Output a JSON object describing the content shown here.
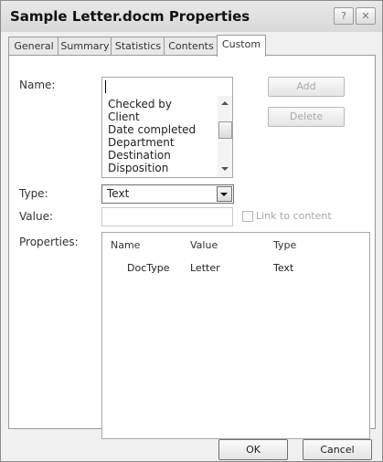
{
  "window": {
    "title": "Sample Letter.docm Properties",
    "help_glyph": "?",
    "close_glyph": "✕"
  },
  "tabs": [
    {
      "label": "General"
    },
    {
      "label": "Summary"
    },
    {
      "label": "Statistics"
    },
    {
      "label": "Contents"
    },
    {
      "label": "Custom",
      "active": true
    }
  ],
  "form": {
    "name_label": "Name:",
    "name_value": "",
    "name_options": [
      "Checked by",
      "Client",
      "Date completed",
      "Department",
      "Destination",
      "Disposition"
    ],
    "type_label": "Type:",
    "type_value": "Text",
    "value_label": "Value:",
    "value_value": "",
    "link_label": "Link to content",
    "link_checked": false,
    "properties_label": "Properties:"
  },
  "buttons": {
    "add": "Add",
    "delete": "Delete",
    "ok": "OK",
    "cancel": "Cancel"
  },
  "properties_table": {
    "columns": [
      "Name",
      "Value",
      "Type"
    ],
    "rows": [
      {
        "name": "DocType",
        "value": "Letter",
        "type": "Text"
      }
    ]
  }
}
